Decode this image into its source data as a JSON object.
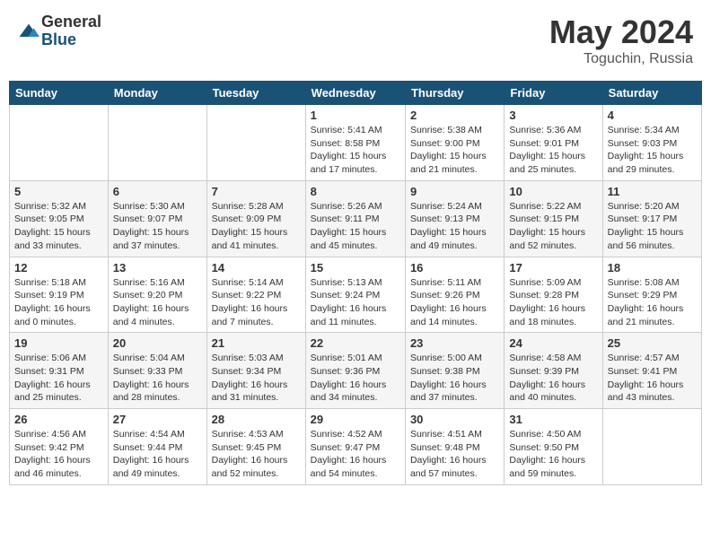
{
  "header": {
    "logo_general": "General",
    "logo_blue": "Blue",
    "month": "May 2024",
    "location": "Toguchin, Russia"
  },
  "days_of_week": [
    "Sunday",
    "Monday",
    "Tuesday",
    "Wednesday",
    "Thursday",
    "Friday",
    "Saturday"
  ],
  "weeks": [
    [
      {
        "day": "",
        "info": ""
      },
      {
        "day": "",
        "info": ""
      },
      {
        "day": "",
        "info": ""
      },
      {
        "day": "1",
        "info": "Sunrise: 5:41 AM\nSunset: 8:58 PM\nDaylight: 15 hours\nand 17 minutes."
      },
      {
        "day": "2",
        "info": "Sunrise: 5:38 AM\nSunset: 9:00 PM\nDaylight: 15 hours\nand 21 minutes."
      },
      {
        "day": "3",
        "info": "Sunrise: 5:36 AM\nSunset: 9:01 PM\nDaylight: 15 hours\nand 25 minutes."
      },
      {
        "day": "4",
        "info": "Sunrise: 5:34 AM\nSunset: 9:03 PM\nDaylight: 15 hours\nand 29 minutes."
      }
    ],
    [
      {
        "day": "5",
        "info": "Sunrise: 5:32 AM\nSunset: 9:05 PM\nDaylight: 15 hours\nand 33 minutes."
      },
      {
        "day": "6",
        "info": "Sunrise: 5:30 AM\nSunset: 9:07 PM\nDaylight: 15 hours\nand 37 minutes."
      },
      {
        "day": "7",
        "info": "Sunrise: 5:28 AM\nSunset: 9:09 PM\nDaylight: 15 hours\nand 41 minutes."
      },
      {
        "day": "8",
        "info": "Sunrise: 5:26 AM\nSunset: 9:11 PM\nDaylight: 15 hours\nand 45 minutes."
      },
      {
        "day": "9",
        "info": "Sunrise: 5:24 AM\nSunset: 9:13 PM\nDaylight: 15 hours\nand 49 minutes."
      },
      {
        "day": "10",
        "info": "Sunrise: 5:22 AM\nSunset: 9:15 PM\nDaylight: 15 hours\nand 52 minutes."
      },
      {
        "day": "11",
        "info": "Sunrise: 5:20 AM\nSunset: 9:17 PM\nDaylight: 15 hours\nand 56 minutes."
      }
    ],
    [
      {
        "day": "12",
        "info": "Sunrise: 5:18 AM\nSunset: 9:19 PM\nDaylight: 16 hours\nand 0 minutes."
      },
      {
        "day": "13",
        "info": "Sunrise: 5:16 AM\nSunset: 9:20 PM\nDaylight: 16 hours\nand 4 minutes."
      },
      {
        "day": "14",
        "info": "Sunrise: 5:14 AM\nSunset: 9:22 PM\nDaylight: 16 hours\nand 7 minutes."
      },
      {
        "day": "15",
        "info": "Sunrise: 5:13 AM\nSunset: 9:24 PM\nDaylight: 16 hours\nand 11 minutes."
      },
      {
        "day": "16",
        "info": "Sunrise: 5:11 AM\nSunset: 9:26 PM\nDaylight: 16 hours\nand 14 minutes."
      },
      {
        "day": "17",
        "info": "Sunrise: 5:09 AM\nSunset: 9:28 PM\nDaylight: 16 hours\nand 18 minutes."
      },
      {
        "day": "18",
        "info": "Sunrise: 5:08 AM\nSunset: 9:29 PM\nDaylight: 16 hours\nand 21 minutes."
      }
    ],
    [
      {
        "day": "19",
        "info": "Sunrise: 5:06 AM\nSunset: 9:31 PM\nDaylight: 16 hours\nand 25 minutes."
      },
      {
        "day": "20",
        "info": "Sunrise: 5:04 AM\nSunset: 9:33 PM\nDaylight: 16 hours\nand 28 minutes."
      },
      {
        "day": "21",
        "info": "Sunrise: 5:03 AM\nSunset: 9:34 PM\nDaylight: 16 hours\nand 31 minutes."
      },
      {
        "day": "22",
        "info": "Sunrise: 5:01 AM\nSunset: 9:36 PM\nDaylight: 16 hours\nand 34 minutes."
      },
      {
        "day": "23",
        "info": "Sunrise: 5:00 AM\nSunset: 9:38 PM\nDaylight: 16 hours\nand 37 minutes."
      },
      {
        "day": "24",
        "info": "Sunrise: 4:58 AM\nSunset: 9:39 PM\nDaylight: 16 hours\nand 40 minutes."
      },
      {
        "day": "25",
        "info": "Sunrise: 4:57 AM\nSunset: 9:41 PM\nDaylight: 16 hours\nand 43 minutes."
      }
    ],
    [
      {
        "day": "26",
        "info": "Sunrise: 4:56 AM\nSunset: 9:42 PM\nDaylight: 16 hours\nand 46 minutes."
      },
      {
        "day": "27",
        "info": "Sunrise: 4:54 AM\nSunset: 9:44 PM\nDaylight: 16 hours\nand 49 minutes."
      },
      {
        "day": "28",
        "info": "Sunrise: 4:53 AM\nSunset: 9:45 PM\nDaylight: 16 hours\nand 52 minutes."
      },
      {
        "day": "29",
        "info": "Sunrise: 4:52 AM\nSunset: 9:47 PM\nDaylight: 16 hours\nand 54 minutes."
      },
      {
        "day": "30",
        "info": "Sunrise: 4:51 AM\nSunset: 9:48 PM\nDaylight: 16 hours\nand 57 minutes."
      },
      {
        "day": "31",
        "info": "Sunrise: 4:50 AM\nSunset: 9:50 PM\nDaylight: 16 hours\nand 59 minutes."
      },
      {
        "day": "",
        "info": ""
      }
    ]
  ]
}
